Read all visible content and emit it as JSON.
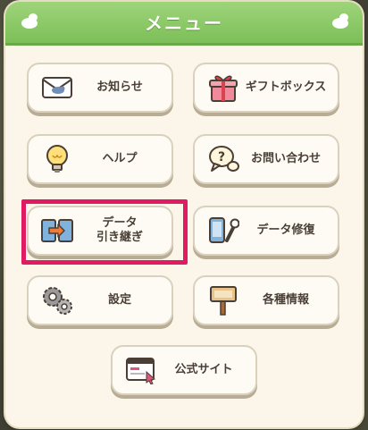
{
  "header": {
    "title": "メニュー"
  },
  "buttons": {
    "news": {
      "label": "お知らせ",
      "icon": "envelope-icon"
    },
    "giftbox": {
      "label": "ギフトボックス",
      "icon": "gift-icon"
    },
    "help": {
      "label": "ヘルプ",
      "icon": "lightbulb-icon"
    },
    "contact": {
      "label": "お問い合わせ",
      "icon": "question-bubble-icon"
    },
    "transfer": {
      "label_line1": "データ",
      "label_line2": "引き継ぎ",
      "icon": "data-transfer-icon"
    },
    "repair": {
      "label": "データ修復",
      "icon": "phone-wrench-icon"
    },
    "settings": {
      "label": "設定",
      "icon": "gears-icon"
    },
    "info": {
      "label": "各種情報",
      "icon": "signboard-icon"
    },
    "website": {
      "label": "公式サイト",
      "icon": "browser-window-icon"
    }
  },
  "colors": {
    "header_green": "#7cbf58",
    "panel": "#fbf6e9",
    "highlight": "#e01a63",
    "text": "#4a3f36"
  }
}
